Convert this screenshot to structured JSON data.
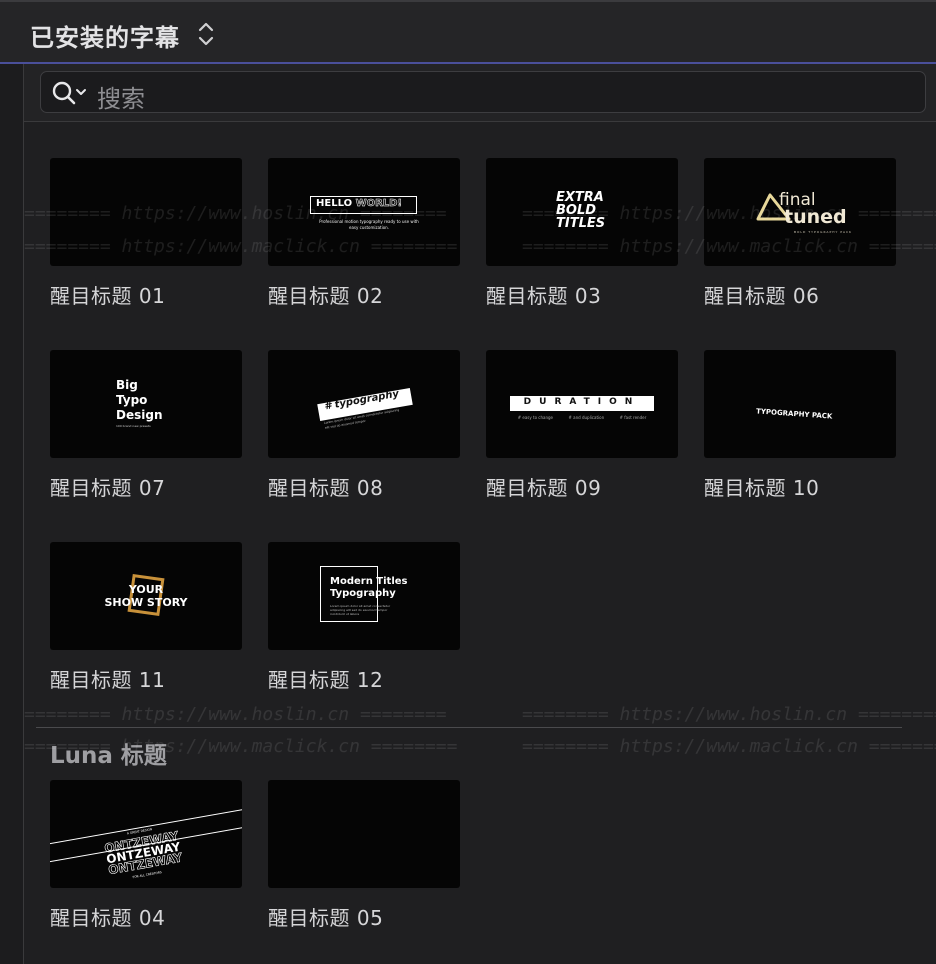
{
  "header": {
    "title": "已安装的字幕"
  },
  "search": {
    "placeholder": "搜索"
  },
  "tiles": [
    {
      "label": "醒目标题 01"
    },
    {
      "label": "醒目标题 02",
      "art": {
        "hello": "HELLO",
        "world": "WORLD!",
        "sub": "Professional motion typography ready to use with easy customization."
      }
    },
    {
      "label": "醒目标题 03",
      "art": {
        "text": "EXTRA\nBOLD\nTITLES"
      }
    },
    {
      "label": "醒目标题 06",
      "art": {
        "final": "final",
        "tuned": "tuned",
        "sub": "BOLD TYPOGRAPHY PACK"
      }
    },
    {
      "label": "醒目标题 07",
      "art": {
        "text": "Big\nTypo\nDesign",
        "sub": "100 brand new presets"
      }
    },
    {
      "label": "醒目标题 08",
      "art": {
        "text": "# typography",
        "sub": "Lorem ipsum dolor sit amet consectetur adipiscing elit sed do eiusmod tempor"
      }
    },
    {
      "label": "醒目标题 09",
      "art": {
        "text": "DURATION",
        "sub1": "# easy to change",
        "sub2": "# and duplication",
        "sub3": "# fast render"
      }
    },
    {
      "label": "醒目标题 10",
      "art": {
        "text": "TYPOGRAPHY PACK"
      }
    },
    {
      "label": "醒目标题 11",
      "art": {
        "text": "YOUR\nSHOW STORY"
      }
    },
    {
      "label": "醒目标题 12",
      "art": {
        "text": "Modern Titles\nTypography",
        "sub": "Lorem ipsum dolor sit amet consectetur adipiscing elit sed do eiusmod tempor incididunt ut labore"
      }
    }
  ],
  "luna_section": {
    "title": "Luna 标题",
    "tiles": [
      {
        "label": "醒目标题 04",
        "art": {
          "top": "A GREAT DESIGN",
          "word": "ONTZEWAY",
          "bottom": "FOR ALL CREATORS"
        }
      },
      {
        "label": "醒目标题 05"
      }
    ]
  },
  "watermarks": {
    "hoslin": "======== https://www.hoslin.cn ========",
    "maclick": "======== https://www.maclick.cn ========"
  },
  "colors": {
    "accent_line": "#4a4f9a",
    "background": "#1f1f21",
    "thumb_bg": "#050505"
  }
}
